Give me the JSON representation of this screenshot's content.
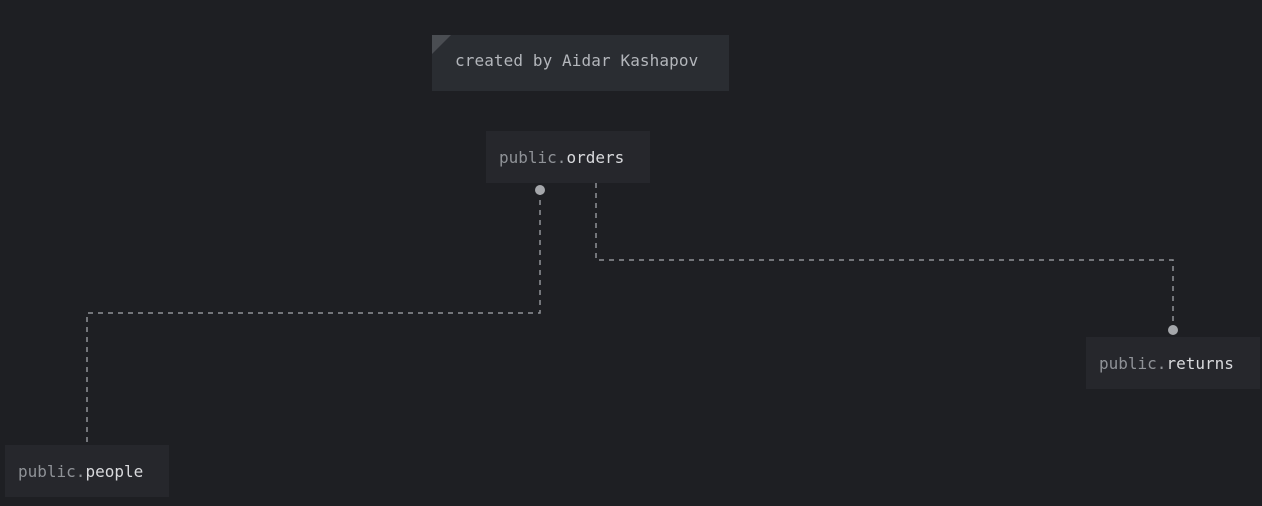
{
  "note": {
    "text": "created by Aidar Kashapov"
  },
  "tables": {
    "orders": {
      "schema": "public.",
      "name": "orders"
    },
    "returns": {
      "schema": "public.",
      "name": "returns"
    },
    "people": {
      "schema": "public.",
      "name": "people"
    }
  },
  "relations": [
    {
      "from": "orders",
      "to": "people"
    },
    {
      "from": "orders",
      "to": "returns"
    }
  ],
  "colors": {
    "background": "#1e1f23",
    "node": "#26272c",
    "note": "#2a2d32",
    "link": "#8f9297"
  }
}
